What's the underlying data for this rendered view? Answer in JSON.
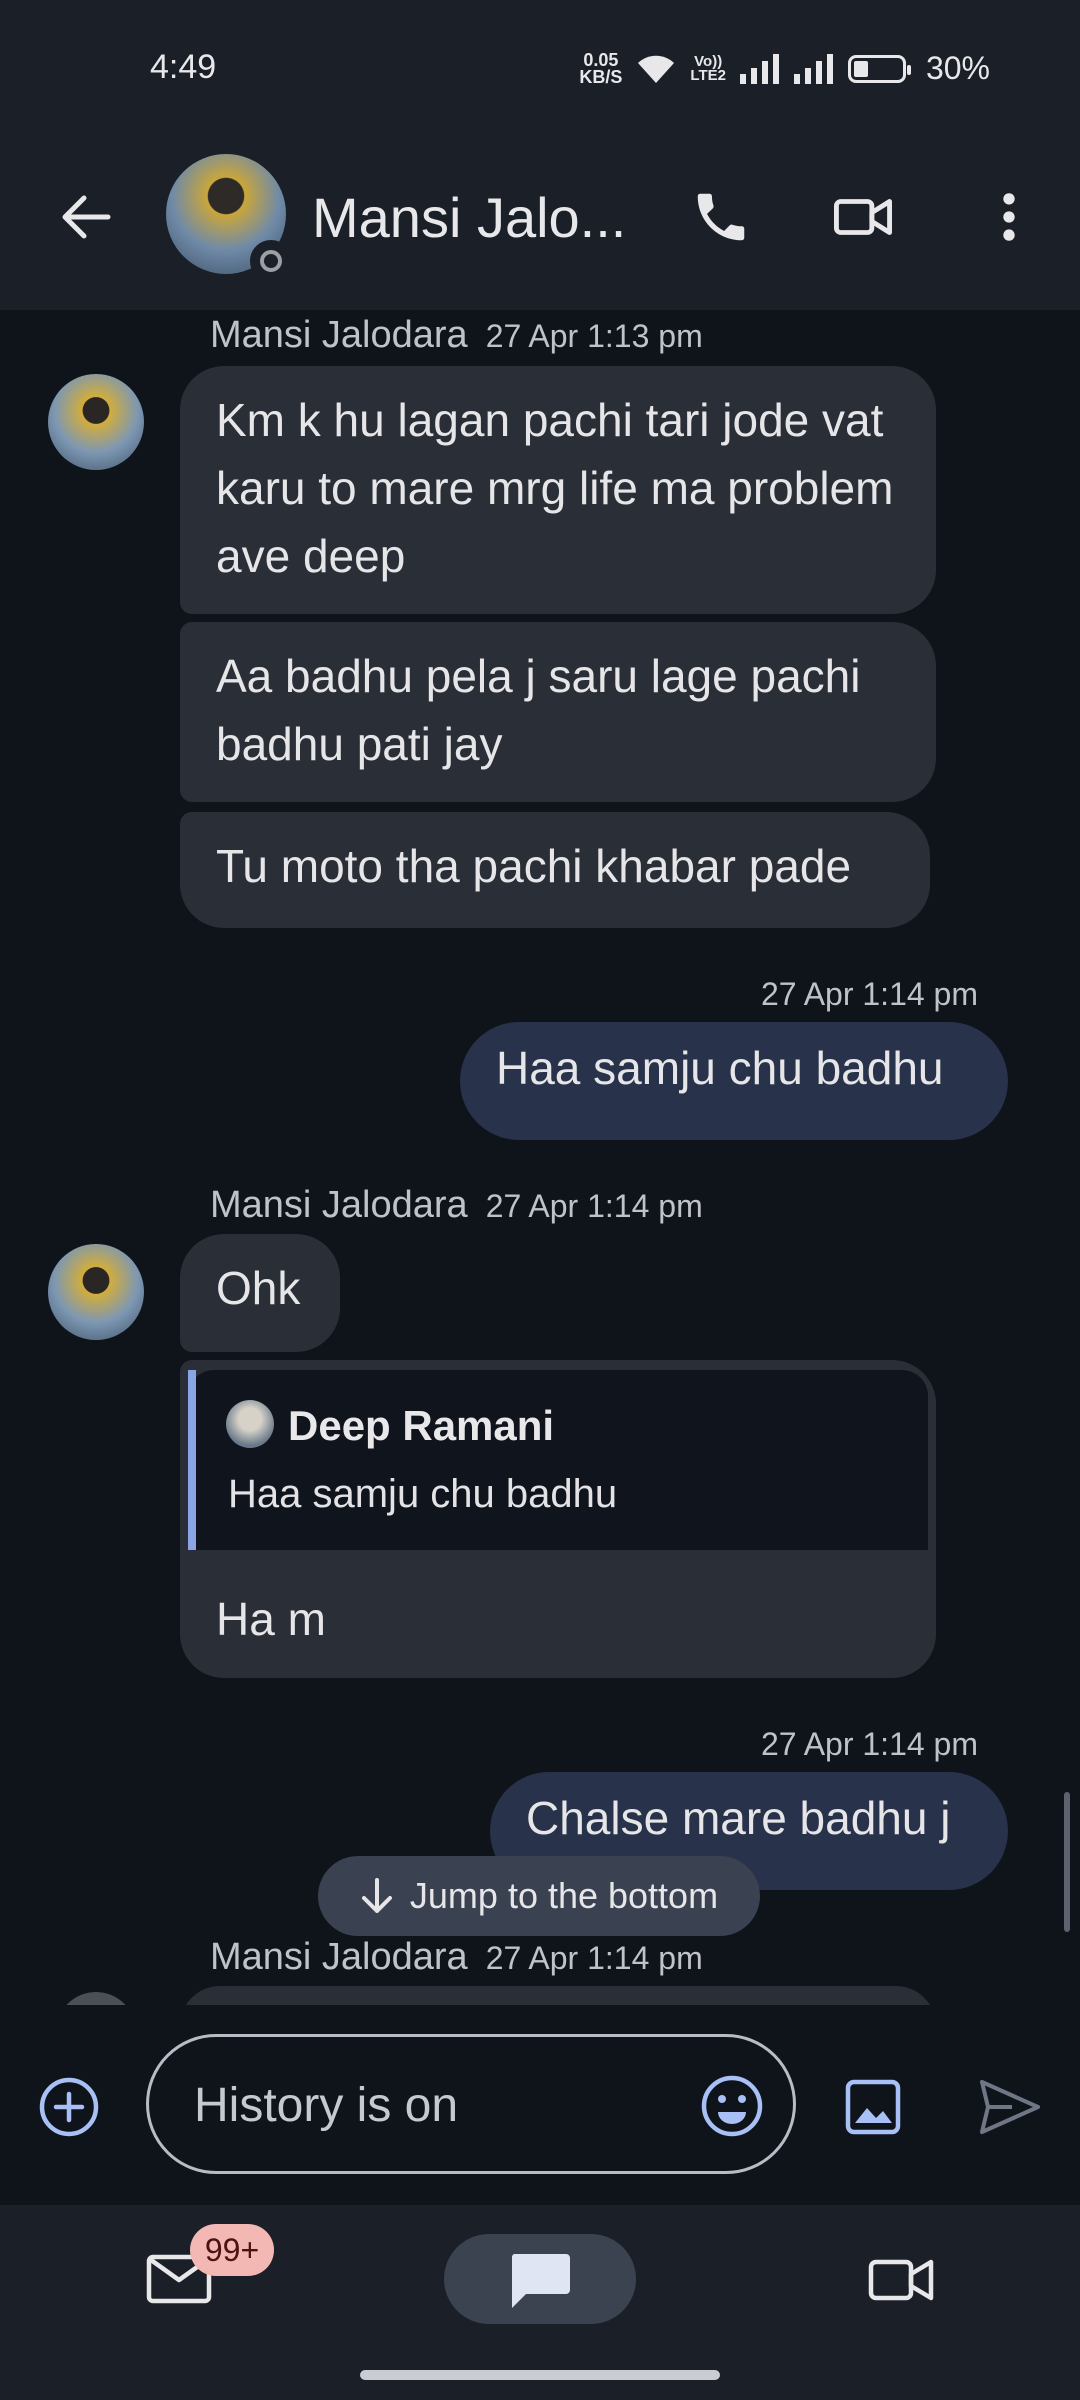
{
  "status_bar": {
    "time": "4:49",
    "speed_value": "0.05",
    "speed_unit": "KB/S",
    "volte_top": "Vo))",
    "volte_bottom": "LTE2",
    "battery": "30%"
  },
  "header": {
    "contact_name": "Mansi Jalo..."
  },
  "messages": [
    {
      "sender": "Mansi Jalodara",
      "time": "27 Apr 1:13 pm",
      "lines": [
        "Km k hu lagan pachi tari jode vat karu to mare mrg life ma problem ave deep",
        "Aa badhu pela j saru lage pachi badhu pati jay",
        "Tu moto tha pachi khabar pade"
      ]
    },
    {
      "time": "27 Apr 1:14 pm",
      "text": "Haa samju chu badhu"
    },
    {
      "sender": "Mansi Jalodara",
      "time": "27 Apr 1:14 pm",
      "text": "Ohk"
    },
    {
      "quote_name": "Deep Ramani",
      "quote_text": "Haa samju chu badhu",
      "text": "Ha m"
    },
    {
      "time": "27 Apr 1:14 pm",
      "text": "Chalse mare badhu j"
    },
    {
      "sender": "Mansi Jalodara",
      "time": "27 Apr 1:14 pm"
    }
  ],
  "jump_button": "Jump to the bottom",
  "composer": {
    "placeholder": "History is on"
  },
  "nav": {
    "mail_badge": "99+"
  }
}
